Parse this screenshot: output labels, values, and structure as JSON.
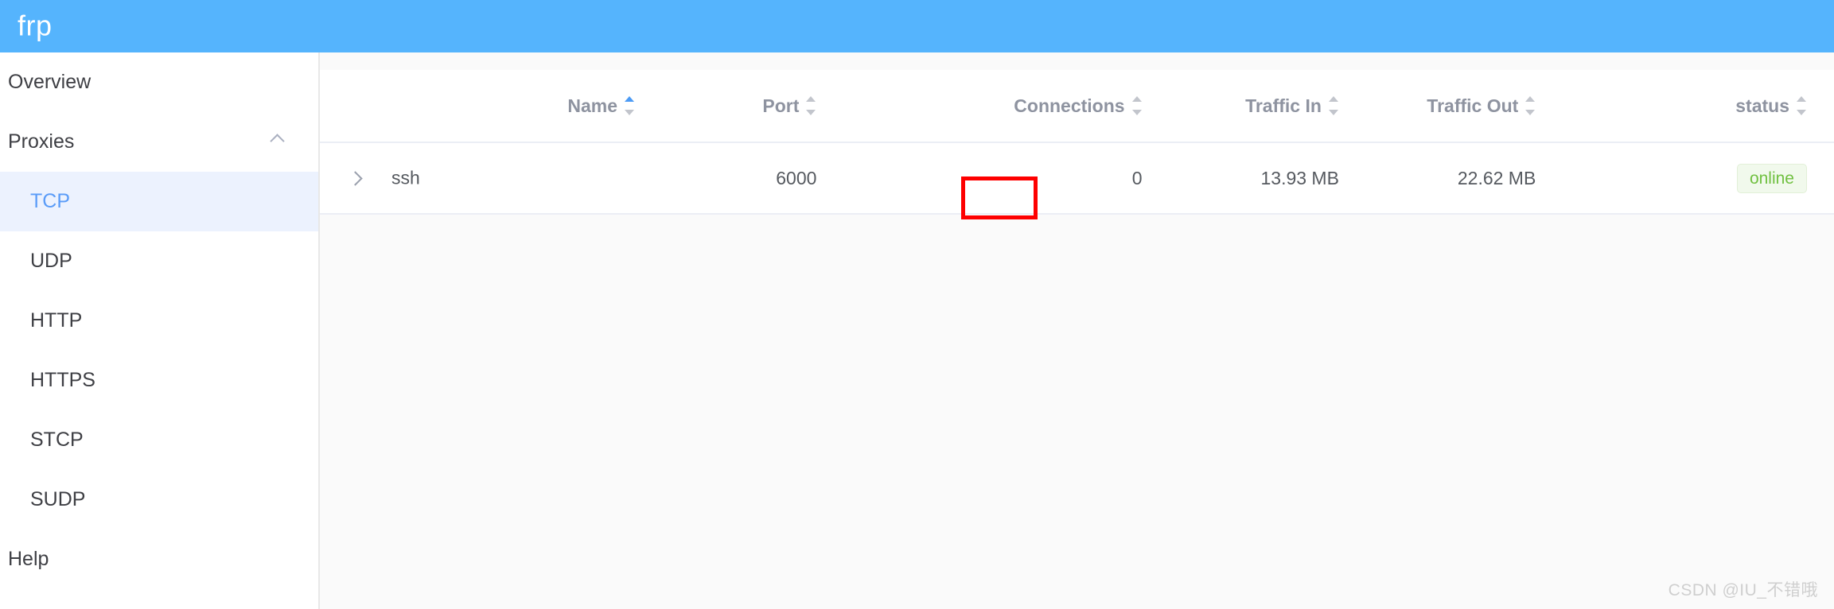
{
  "header": {
    "title": "frp",
    "background_color": "#55b4fd"
  },
  "sidebar": {
    "items": [
      {
        "label": "Overview",
        "level": 0,
        "selected": false,
        "icon": null
      },
      {
        "label": "Proxies",
        "level": 0,
        "selected": false,
        "icon": "chevron-up-icon"
      },
      {
        "label": "TCP",
        "level": 1,
        "selected": true,
        "icon": null
      },
      {
        "label": "UDP",
        "level": 1,
        "selected": false,
        "icon": null
      },
      {
        "label": "HTTP",
        "level": 1,
        "selected": false,
        "icon": null
      },
      {
        "label": "HTTPS",
        "level": 1,
        "selected": false,
        "icon": null
      },
      {
        "label": "STCP",
        "level": 1,
        "selected": false,
        "icon": null
      },
      {
        "label": "SUDP",
        "level": 1,
        "selected": false,
        "icon": null
      },
      {
        "label": "Help",
        "level": 0,
        "selected": false,
        "icon": null
      }
    ],
    "selected_text_color": "#5a9cf8",
    "selected_background_color": "#ecf2fe"
  },
  "table": {
    "columns": [
      {
        "label": "Name",
        "sort": "asc",
        "sortable": true
      },
      {
        "label": "Port",
        "sort": "none",
        "sortable": true
      },
      {
        "label": "Connections",
        "sort": "none",
        "sortable": true
      },
      {
        "label": "Traffic In",
        "sort": "none",
        "sortable": true
      },
      {
        "label": "Traffic Out",
        "sort": "none",
        "sortable": true
      },
      {
        "label": "status",
        "sort": "none",
        "sortable": true
      }
    ],
    "rows": [
      {
        "expand_icon": "chevron-right-icon",
        "name": "ssh",
        "port": "6000",
        "connections": "0",
        "traffic_in": "13.93 MB",
        "traffic_out": "22.62 MB",
        "status": "online"
      }
    ]
  },
  "annotations": {
    "color": "#fe0000",
    "boxes": [
      {
        "target": "port-cell-value",
        "value": "6000"
      },
      {
        "target": "status-cell-badge",
        "value": "online"
      }
    ]
  },
  "status_colors": {
    "online_text": "#70c040",
    "online_background": "#f1f9ec"
  },
  "watermark": {
    "text": "CSDN @IU_不错哦"
  }
}
